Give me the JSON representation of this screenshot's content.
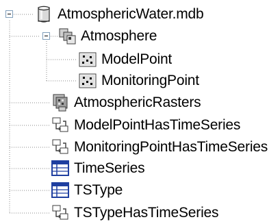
{
  "tree": {
    "root": {
      "label": "AtmosphericWater.mdb",
      "icon": "database-cylinder-icon",
      "expanded": true
    },
    "dataset": {
      "label": "Atmosphere",
      "icon": "feature-dataset-icon",
      "expanded": true,
      "children": [
        {
          "label": "ModelPoint",
          "icon": "point-feature-class-icon"
        },
        {
          "label": "MonitoringPoint",
          "icon": "point-feature-class-icon"
        }
      ]
    },
    "items": [
      {
        "label": "AtmosphericRasters",
        "icon": "raster-catalog-icon"
      },
      {
        "label": "ModelPointHasTimeSeries",
        "icon": "relationship-class-icon"
      },
      {
        "label": "MonitoringPointHasTimeSeries",
        "icon": "relationship-class-icon"
      },
      {
        "label": "TimeSeries",
        "icon": "table-icon"
      },
      {
        "label": "TSType",
        "icon": "table-icon"
      },
      {
        "label": "TSTypeHasTimeSeries",
        "icon": "relationship-class-icon"
      }
    ]
  },
  "colors": {
    "connector": "#8a8a8a",
    "expander_border": "#7f9db9",
    "table_blue": "#1f3fa0",
    "icon_gray": "#bdbdbd",
    "icon_dark": "#3c3c3c"
  }
}
